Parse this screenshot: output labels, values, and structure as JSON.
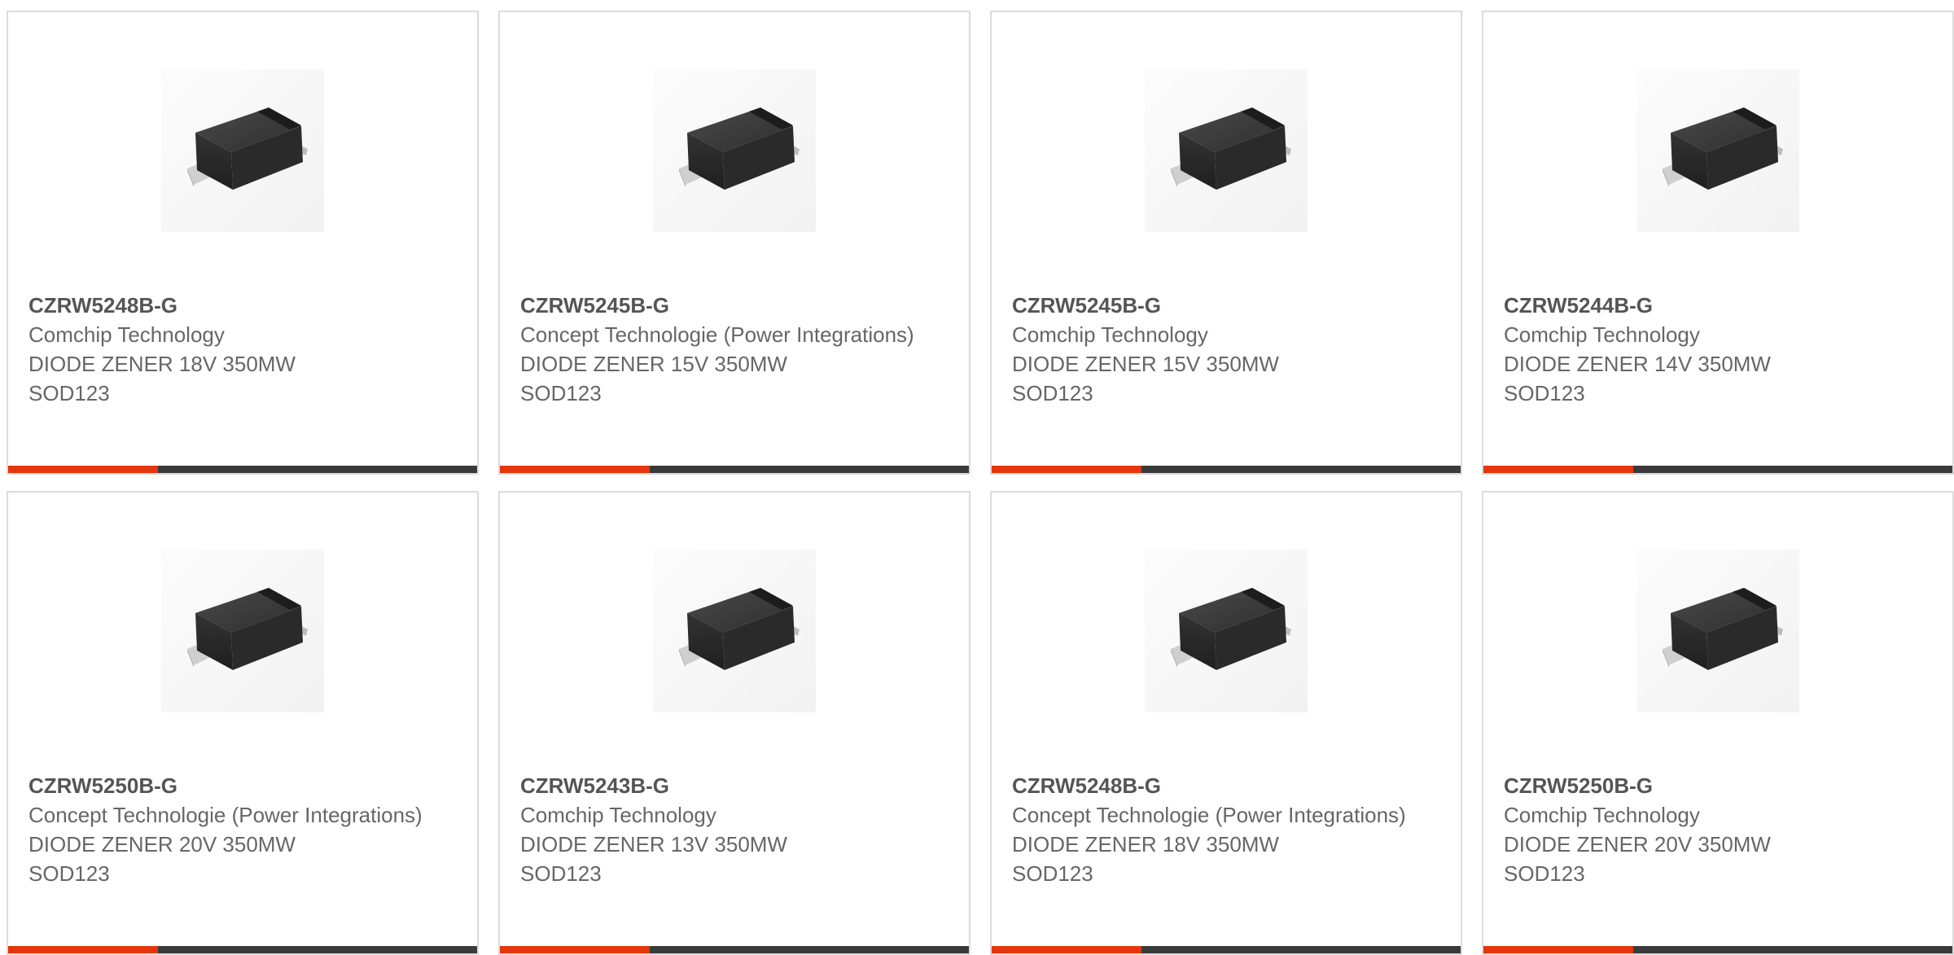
{
  "theme": {
    "accent_color": "#e3360c",
    "bar_color": "#3a3a3a",
    "text_color": "#666666"
  },
  "products": [
    {
      "part_number": "CZRW5248B-G",
      "manufacturer": "Comchip Technology",
      "description_line1": "DIODE ZENER 18V 350MW",
      "description_line2": "SOD123",
      "image": "sod123-diode-icon"
    },
    {
      "part_number": "CZRW5245B-G",
      "manufacturer": "Concept Technologie (Power Integrations)",
      "description_line1": "DIODE ZENER 15V 350MW",
      "description_line2": "SOD123",
      "image": "sod123-diode-icon"
    },
    {
      "part_number": "CZRW5245B-G",
      "manufacturer": "Comchip Technology",
      "description_line1": "DIODE ZENER 15V 350MW",
      "description_line2": "SOD123",
      "image": "sod123-diode-icon"
    },
    {
      "part_number": "CZRW5244B-G",
      "manufacturer": "Comchip Technology",
      "description_line1": "DIODE ZENER 14V 350MW",
      "description_line2": "SOD123",
      "image": "sod123-diode-icon"
    },
    {
      "part_number": "CZRW5250B-G",
      "manufacturer": "Concept Technologie (Power Integrations)",
      "description_line1": "DIODE ZENER 20V 350MW",
      "description_line2": "SOD123",
      "image": "sod123-diode-icon"
    },
    {
      "part_number": "CZRW5243B-G",
      "manufacturer": "Comchip Technology",
      "description_line1": "DIODE ZENER 13V 350MW",
      "description_line2": "SOD123",
      "image": "sod123-diode-icon"
    },
    {
      "part_number": "CZRW5248B-G",
      "manufacturer": "Concept Technologie (Power Integrations)",
      "description_line1": "DIODE ZENER 18V 350MW",
      "description_line2": "SOD123",
      "image": "sod123-diode-icon"
    },
    {
      "part_number": "CZRW5250B-G",
      "manufacturer": "Comchip Technology",
      "description_line1": "DIODE ZENER 20V 350MW",
      "description_line2": "SOD123",
      "image": "sod123-diode-icon"
    }
  ]
}
